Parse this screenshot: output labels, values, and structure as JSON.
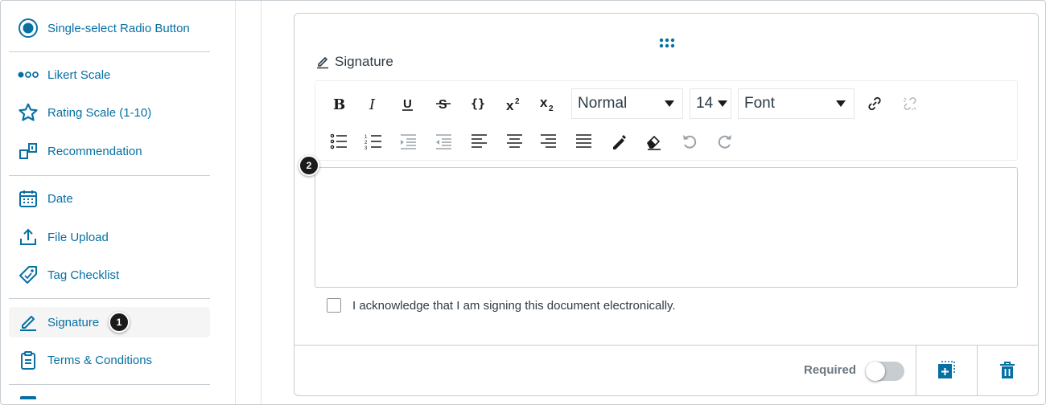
{
  "sidebar": {
    "items": [
      {
        "label": "Single-select Radio Button",
        "icon": "radio-button-icon"
      },
      {
        "label": "Likert Scale",
        "icon": "likert-dots-icon"
      },
      {
        "label": "Rating Scale (1-10)",
        "icon": "star-icon"
      },
      {
        "label": "Recommendation",
        "icon": "recommendation-icon"
      },
      {
        "label": "Date",
        "icon": "calendar-icon"
      },
      {
        "label": "File Upload",
        "icon": "upload-icon"
      },
      {
        "label": "Tag Checklist",
        "icon": "tag-icon"
      },
      {
        "label": "Signature",
        "icon": "pencil-icon",
        "active": true
      },
      {
        "label": "Terms & Conditions",
        "icon": "clipboard-icon"
      }
    ]
  },
  "callouts": {
    "one": "1",
    "two": "2"
  },
  "question": {
    "title": "Signature",
    "toolbar": {
      "paragraph_format": "Normal",
      "font_size": "14",
      "font_family": "Font",
      "buttons_row1": [
        "bold-icon",
        "italic-icon",
        "underline-icon",
        "strikethrough-icon",
        "code-braces-icon",
        "superscript-icon",
        "subscript-icon",
        "link-icon",
        "unlink-icon"
      ],
      "buttons_row2": [
        "bullet-list-icon",
        "numbered-list-icon",
        "indent-icon",
        "outdent-icon",
        "align-left-icon",
        "align-center-icon",
        "align-right-icon",
        "justify-icon",
        "text-color-icon",
        "clear-format-icon",
        "undo-icon",
        "redo-icon"
      ]
    },
    "editor_value": "",
    "acknowledge_label": "I acknowledge that I am signing this document electronically.",
    "acknowledge_checked": false
  },
  "footer": {
    "required_label": "Required",
    "required_on": false
  },
  "colors": {
    "accent": "#0770a3",
    "text": "#2d3b45",
    "border": "#c7cdd1"
  }
}
